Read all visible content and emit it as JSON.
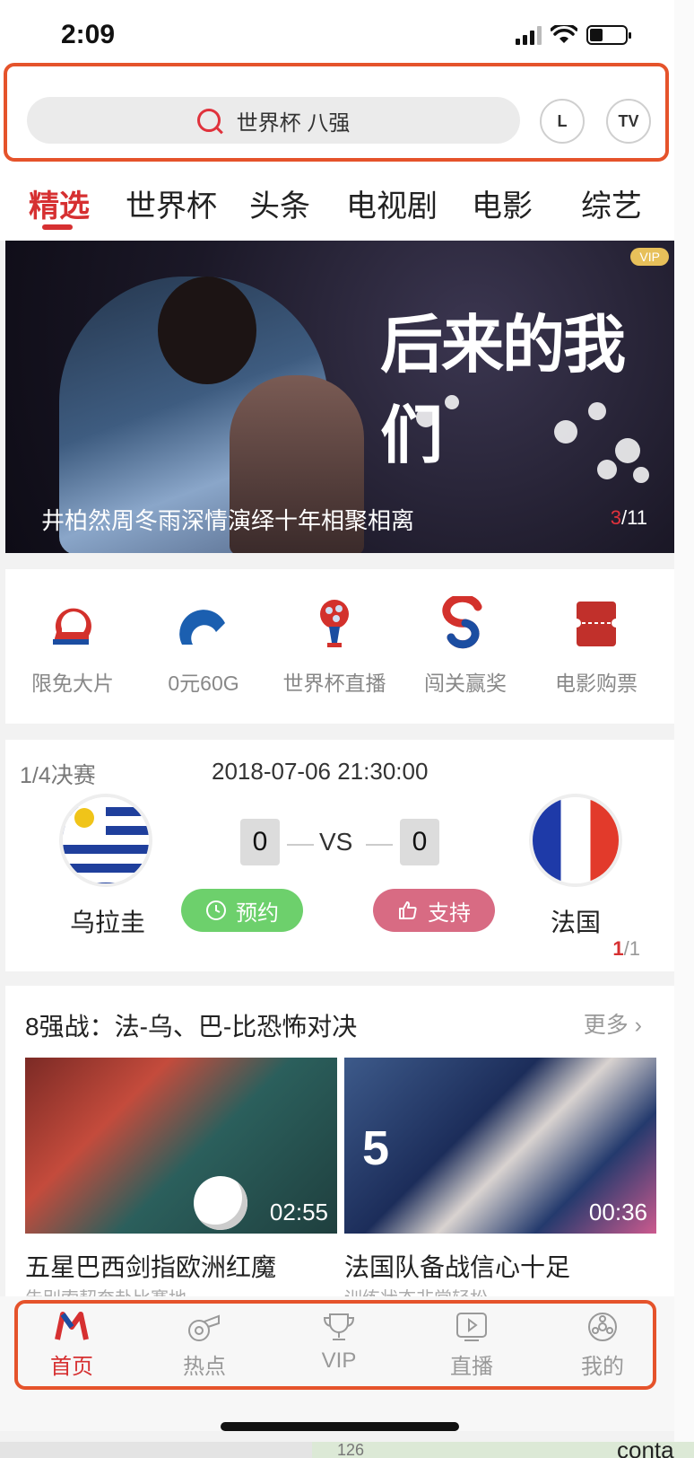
{
  "status_bar": {
    "time": "2:09"
  },
  "search": {
    "query": "世界杯 八强",
    "btn_l": "L",
    "btn_tv": "TV"
  },
  "tabs": [
    "精选",
    "世界杯",
    "头条",
    "电视剧",
    "电影",
    "综艺"
  ],
  "banner": {
    "title_art": "后来的我们",
    "vip": "VIP",
    "caption": "井柏然周冬雨深情演绎十年相聚相离",
    "page_current": "3",
    "page_total": "/11"
  },
  "quick_links": [
    "限免大片",
    "0元60G",
    "世界杯直播",
    "闯关赢奖",
    "电影购票"
  ],
  "match": {
    "round": "1/4决赛",
    "datetime": "2018-07-06 21:30:00",
    "home_team": "乌拉圭",
    "away_team": "法国",
    "home_score": "0",
    "away_score": "0",
    "vs": "VS",
    "reserve_label": "预约",
    "support_label": "支持",
    "page_current": "1",
    "page_total": "/1"
  },
  "news": {
    "section_title": "8强战：法-乌、巴-比恐怖对决",
    "more_label": "更多",
    "items": [
      {
        "title": "五星巴西剑指欧洲红魔",
        "subtitle": "告别索契奔赴比赛地",
        "duration": "02:55"
      },
      {
        "title": "法国队备战信心十足",
        "subtitle": "训练状态非常轻松",
        "duration": "00:36",
        "jersey_number": "5"
      }
    ]
  },
  "tab_bar": [
    "首页",
    "热点",
    "VIP",
    "直播",
    "我的"
  ],
  "background_strip": {
    "number": "126",
    "text": "conta"
  },
  "colors": {
    "accent": "#d63031",
    "highlight_outline": "#e5532b",
    "green_pill": "#6dd06c",
    "pink_pill": "#d86b83"
  }
}
